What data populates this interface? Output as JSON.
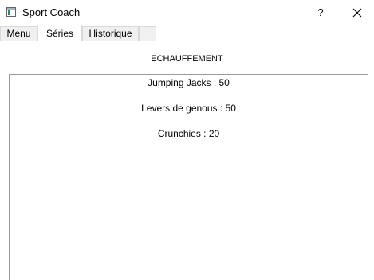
{
  "window": {
    "title": "Sport Coach",
    "help_label": "?",
    "icon": "app-window-icon",
    "close_icon": "close-icon"
  },
  "tabs": [
    {
      "label": "Menu",
      "selected": false
    },
    {
      "label": "Séries",
      "selected": true
    },
    {
      "label": "Historique",
      "selected": false
    },
    {
      "label": "",
      "selected": false
    }
  ],
  "series": {
    "heading": "ECHAUFFEMENT",
    "exercises": [
      {
        "text": "Jumping Jacks : 50"
      },
      {
        "text": "Levers de genous : 50"
      },
      {
        "text": "Crunchies : 20"
      }
    ]
  }
}
